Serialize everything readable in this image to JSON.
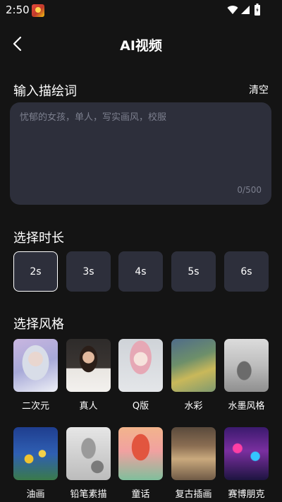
{
  "status_bar": {
    "time": "2:50"
  },
  "header": {
    "title": "AI视频"
  },
  "prompt": {
    "section_title": "输入描绘词",
    "clear_label": "清空",
    "placeholder": "忧郁的女孩，单人，写实画风，校服",
    "value": "",
    "count": "0/500"
  },
  "duration": {
    "section_title": "选择时长",
    "options": [
      "2s",
      "3s",
      "4s",
      "5s",
      "6s"
    ],
    "selected": "2s"
  },
  "style": {
    "section_title": "选择风格",
    "items": [
      {
        "label": "二次元"
      },
      {
        "label": "真人"
      },
      {
        "label": "Q版"
      },
      {
        "label": "水彩"
      },
      {
        "label": "水墨风格"
      },
      {
        "label": "油画"
      },
      {
        "label": "铅笔素描"
      },
      {
        "label": "童话"
      },
      {
        "label": "复古插画"
      },
      {
        "label": "赛博朋克"
      }
    ]
  },
  "colors": {
    "background": "#141414",
    "card": "#2d2f3b",
    "muted_text": "#7c7f8e"
  }
}
